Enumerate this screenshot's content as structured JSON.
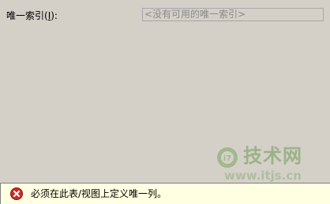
{
  "unique_index": {
    "label": "唯一索引",
    "accelerator_prefix": "(",
    "accelerator_key": "I",
    "accelerator_suffix": "):",
    "selected_value": "<没有可用的唯一索引>"
  },
  "status": {
    "icon": "error-icon",
    "message": "必须在此表/视图上定义唯一列。"
  },
  "watermark": {
    "title": "技术网",
    "url": "www.itjs.cn",
    "mark": "i7"
  },
  "colors": {
    "dialog_background": "#d4d0c8",
    "status_background": "#ffffe1",
    "error_red": "#cc2b2b",
    "watermark_green": "#6e9a55"
  }
}
